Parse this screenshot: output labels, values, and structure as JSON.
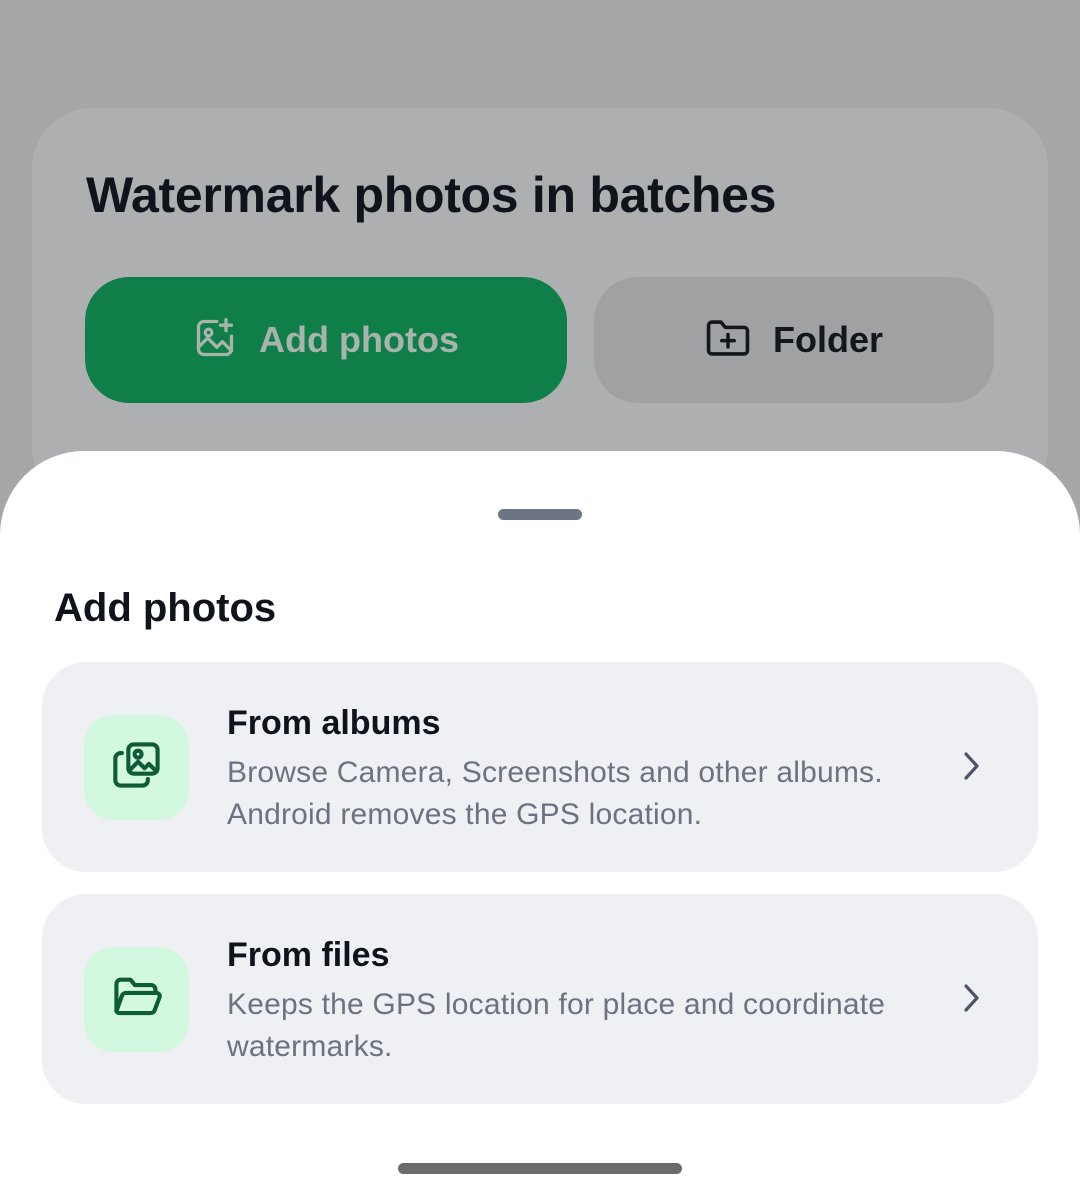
{
  "background": {
    "title": "Watermark photos in batches",
    "add_photos_button": {
      "label": "Add photos",
      "icon": "image-plus-icon"
    },
    "folder_button": {
      "label": "Folder",
      "icon": "folder-plus-icon"
    }
  },
  "sheet": {
    "title": "Add photos",
    "options": [
      {
        "title": "From albums",
        "description": "Browse Camera, Screenshots and other albums. Android removes the GPS location.",
        "icon": "image-stack-icon"
      },
      {
        "title": "From files",
        "description": "Keeps the GPS location for place and coordinate watermarks.",
        "icon": "folder-open-icon"
      }
    ]
  },
  "colors": {
    "accent_green": "#0f7e48",
    "icon_green": "#0e5b37",
    "icon_bg_green": "#d3f8e0",
    "scrim": "#a5a6a8"
  }
}
